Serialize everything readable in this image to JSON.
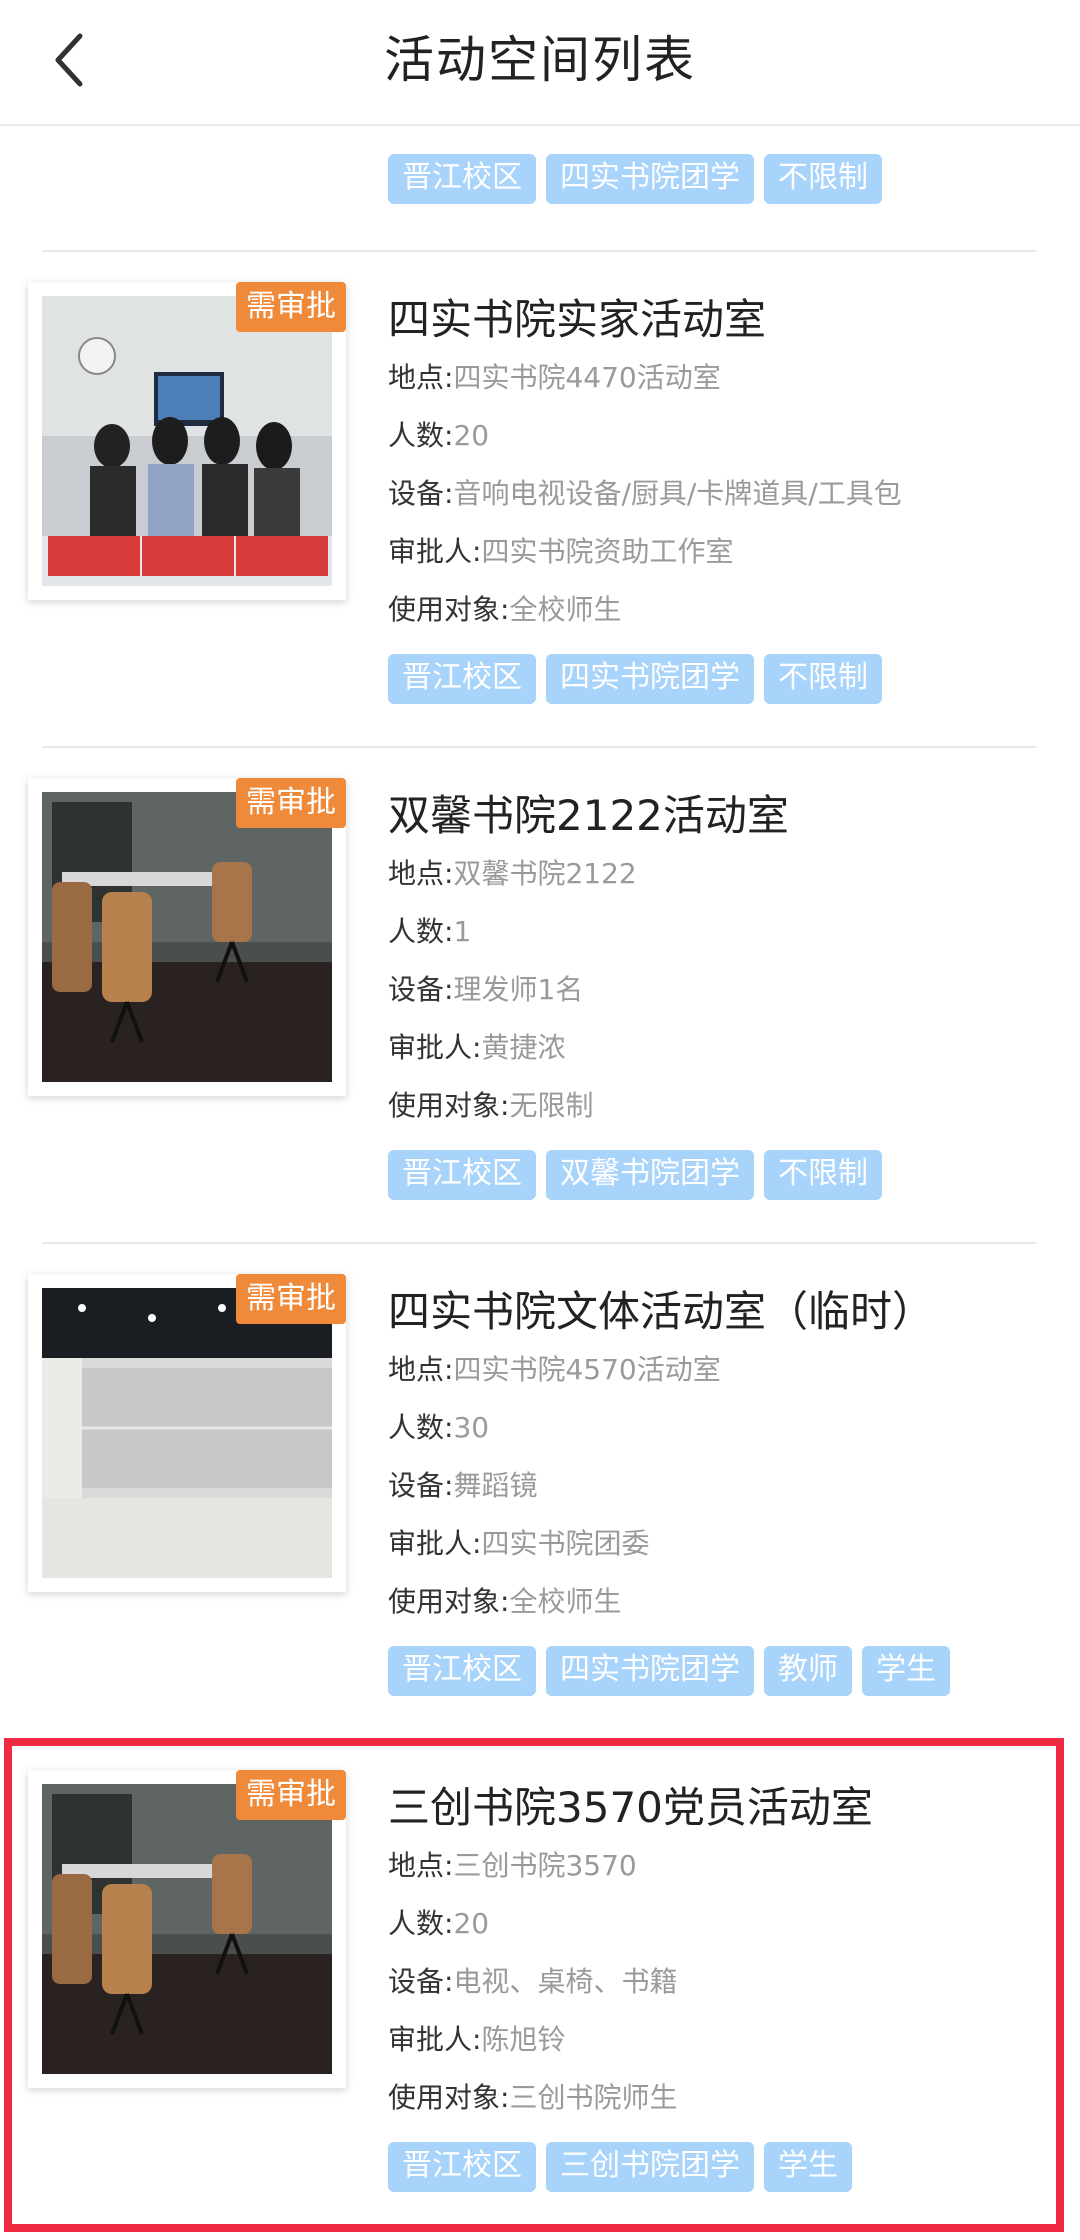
{
  "header": {
    "title": "活动空间列表",
    "back_icon": "chevron-left-icon"
  },
  "top_tags": [
    "晋江校区",
    "四实书院团学",
    "不限制"
  ],
  "labels": {
    "location": "地点:",
    "capacity": "人数:",
    "equipment": "设备:",
    "approver": "审批人:",
    "audience": "使用对象:"
  },
  "colors": {
    "tag_bg": "#a8d3fb",
    "badge_bg": "#f08a3b",
    "highlight_border": "#f02a43"
  },
  "rooms": [
    {
      "badge": "需审批",
      "title": "四实书院实家活动室",
      "location": "四实书院4470活动室",
      "capacity": "20",
      "equipment": "音响电视设备/厨具/卡牌道具/工具包",
      "approver": "四实书院资助工作室",
      "audience": "全校师生",
      "tags": [
        "晋江校区",
        "四实书院团学",
        "不限制"
      ]
    },
    {
      "badge": "需审批",
      "title": "双馨书院2122活动室",
      "location": "双馨书院2122",
      "capacity": "1",
      "equipment": "理发师1名",
      "approver": "黄捷浓",
      "audience": "无限制",
      "tags": [
        "晋江校区",
        "双馨书院团学",
        "不限制"
      ]
    },
    {
      "badge": "需审批",
      "title": "四实书院文体活动室（临时）",
      "location": "四实书院4570活动室",
      "capacity": "30",
      "equipment": "舞蹈镜",
      "approver": "四实书院团委",
      "audience": "全校师生",
      "tags": [
        "晋江校区",
        "四实书院团学",
        "教师",
        "学生"
      ]
    },
    {
      "badge": "需审批",
      "title": "三创书院3570党员活动室",
      "location": "三创书院3570",
      "capacity": "20",
      "equipment": "电视、桌椅、书籍",
      "approver": "陈旭铃",
      "audience": "三创书院师生",
      "tags": [
        "晋江校区",
        "三创书院团学",
        "学生"
      ]
    }
  ]
}
